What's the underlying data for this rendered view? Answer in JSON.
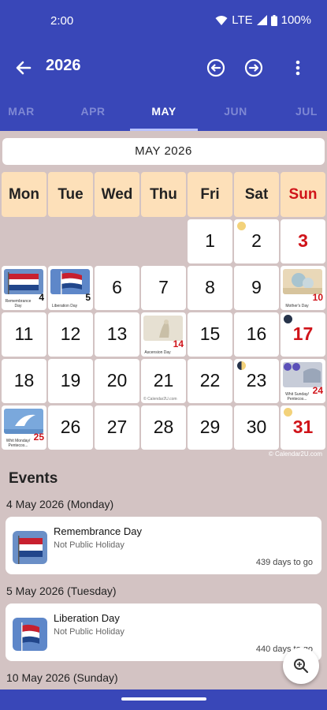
{
  "status_bar": {
    "time": "2:00",
    "network": "LTE",
    "battery": "100%"
  },
  "app_bar": {
    "title": "2026"
  },
  "tabs": [
    {
      "label": "MAR"
    },
    {
      "label": "APR"
    },
    {
      "label": "MAY",
      "active": true
    },
    {
      "label": "JUN"
    },
    {
      "label": "JUL"
    }
  ],
  "month_label": "MAY 2026",
  "weekdays": [
    "Mon",
    "Tue",
    "Wed",
    "Thu",
    "Fri",
    "Sat",
    "Sun"
  ],
  "calendar": {
    "days": [
      {
        "day": "1"
      },
      {
        "day": "2",
        "moon": "first-quarter"
      },
      {
        "day": "3",
        "sunday": true
      },
      {
        "day": "4",
        "caption": "Remembrance Day",
        "thumb": "flag"
      },
      {
        "day": "5",
        "caption": "Liberation Day",
        "thumb": "flag"
      },
      {
        "day": "6"
      },
      {
        "day": "7"
      },
      {
        "day": "8"
      },
      {
        "day": "9"
      },
      {
        "day": "10",
        "sunday": true,
        "caption": "Mother's Day",
        "thumb": "photo"
      },
      {
        "day": "11"
      },
      {
        "day": "12"
      },
      {
        "day": "13"
      },
      {
        "day": "14",
        "sunday_style": true,
        "caption": "Ascension Day",
        "thumb": "photo"
      },
      {
        "day": "15"
      },
      {
        "day": "16"
      },
      {
        "day": "17",
        "sunday": true,
        "moon": "new-moon"
      },
      {
        "day": "18"
      },
      {
        "day": "19"
      },
      {
        "day": "20"
      },
      {
        "day": "21",
        "watermark": "© Calendar2U.com"
      },
      {
        "day": "22"
      },
      {
        "day": "23",
        "moon": "first-quarter-half"
      },
      {
        "day": "24",
        "sunday": true,
        "caption": "Whit Sunday/ Pentecos...",
        "thumb": "photo"
      },
      {
        "day": "25",
        "caption": "Whit Monday/ Pentecos...",
        "thumb": "photo"
      },
      {
        "day": "26"
      },
      {
        "day": "27"
      },
      {
        "day": "28"
      },
      {
        "day": "29"
      },
      {
        "day": "30"
      },
      {
        "day": "31",
        "sunday": true,
        "moon": "full-moon"
      }
    ],
    "credit": "© Calendar2U.com"
  },
  "events_title": "Events",
  "events": [
    {
      "date": "4 May 2026 (Monday)",
      "name": "Remembrance Day",
      "type": "Not Public Holiday",
      "countdown": "439 days to go"
    },
    {
      "date": "5 May 2026 (Tuesday)",
      "name": "Liberation Day",
      "type": "Not Public Holiday",
      "countdown": "440 days to go"
    },
    {
      "date": "10 May 2026 (Sunday)"
    }
  ],
  "colors": {
    "primary": "#3947b8",
    "background": "#d3c3c3",
    "weekday_header": "#fde0b9",
    "sunday_red": "#d0141a"
  },
  "icons": [
    "back-arrow-icon",
    "previous-year-icon",
    "next-year-icon",
    "overflow-menu-icon",
    "zoom-icon",
    "wifi-icon",
    "signal-icon",
    "battery-icon"
  ]
}
